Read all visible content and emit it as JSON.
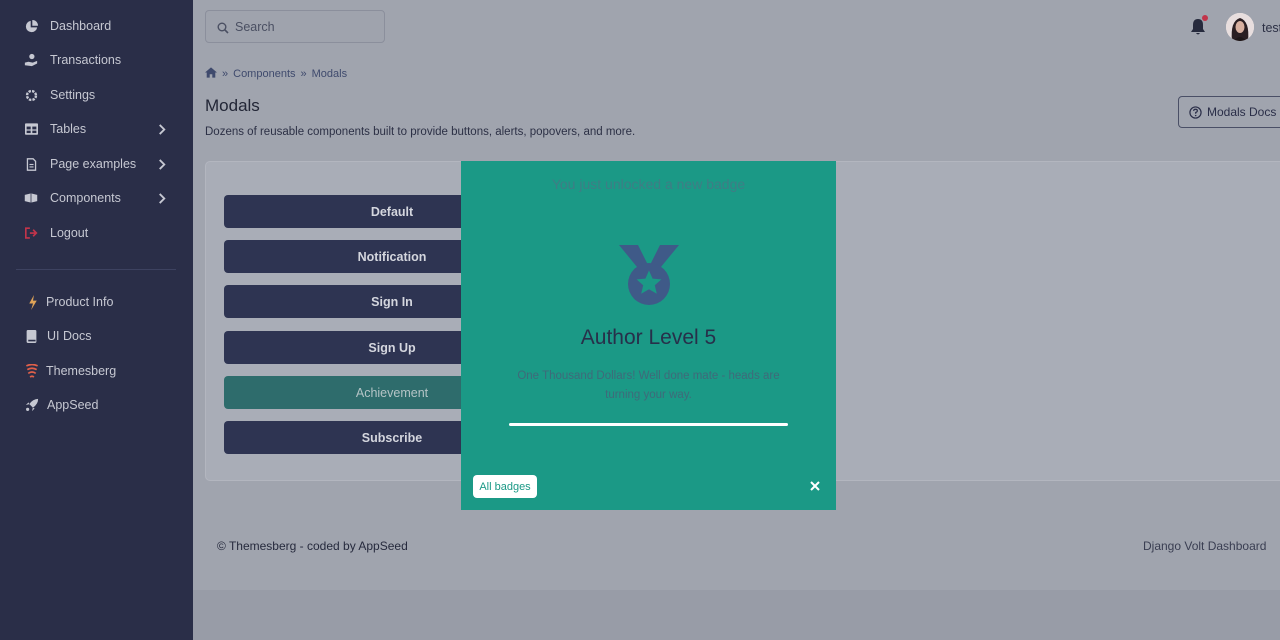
{
  "sidebar": {
    "items": [
      {
        "label": "Dashboard",
        "icon": "chart-pie-icon"
      },
      {
        "label": "Transactions",
        "icon": "hand-holding-usd-icon"
      },
      {
        "label": "Settings",
        "icon": "cog-icon"
      },
      {
        "label": "Tables",
        "icon": "table-icon"
      },
      {
        "label": "Page examples",
        "icon": "file-icon"
      },
      {
        "label": "Components",
        "icon": "box-open-icon"
      },
      {
        "label": "Logout",
        "icon": "sign-out-icon"
      },
      {
        "label": "Product Info",
        "icon": "bolt-icon"
      },
      {
        "label": "UI Docs",
        "icon": "book-icon"
      },
      {
        "label": "Themesberg",
        "icon": "themesberg-logo-icon"
      },
      {
        "label": "AppSeed",
        "icon": "rocket-icon"
      }
    ]
  },
  "topbar": {
    "search_placeholder": "Search",
    "user_name": "test"
  },
  "breadcrumb": {
    "items": [
      "Components",
      "Modals"
    ]
  },
  "page": {
    "title": "Modals",
    "subtitle": "Dozens of reusable components built to provide buttons, alerts, popovers, and more.",
    "docs_button": "Modals Docs"
  },
  "buttons": [
    "Default",
    "Notification",
    "Sign In",
    "Sign Up",
    "Achievement",
    "Subscribe"
  ],
  "modal": {
    "top_text": "You just unlocked a new badge",
    "heading": "Author Level 5",
    "text": "One Thousand Dollars! Well done mate - heads are turning your way.",
    "progress_percent": 100,
    "all_badges_button": "All badges"
  },
  "footer": {
    "left": "© Themesberg - coded by AppSeed",
    "right": "Django Volt Dashboard"
  },
  "colors": {
    "sidebar_bg": "#2a2e48",
    "modal_bg": "#1b9986",
    "logout_icon": "#c2344a",
    "product_info_icon": "#e0a458"
  }
}
